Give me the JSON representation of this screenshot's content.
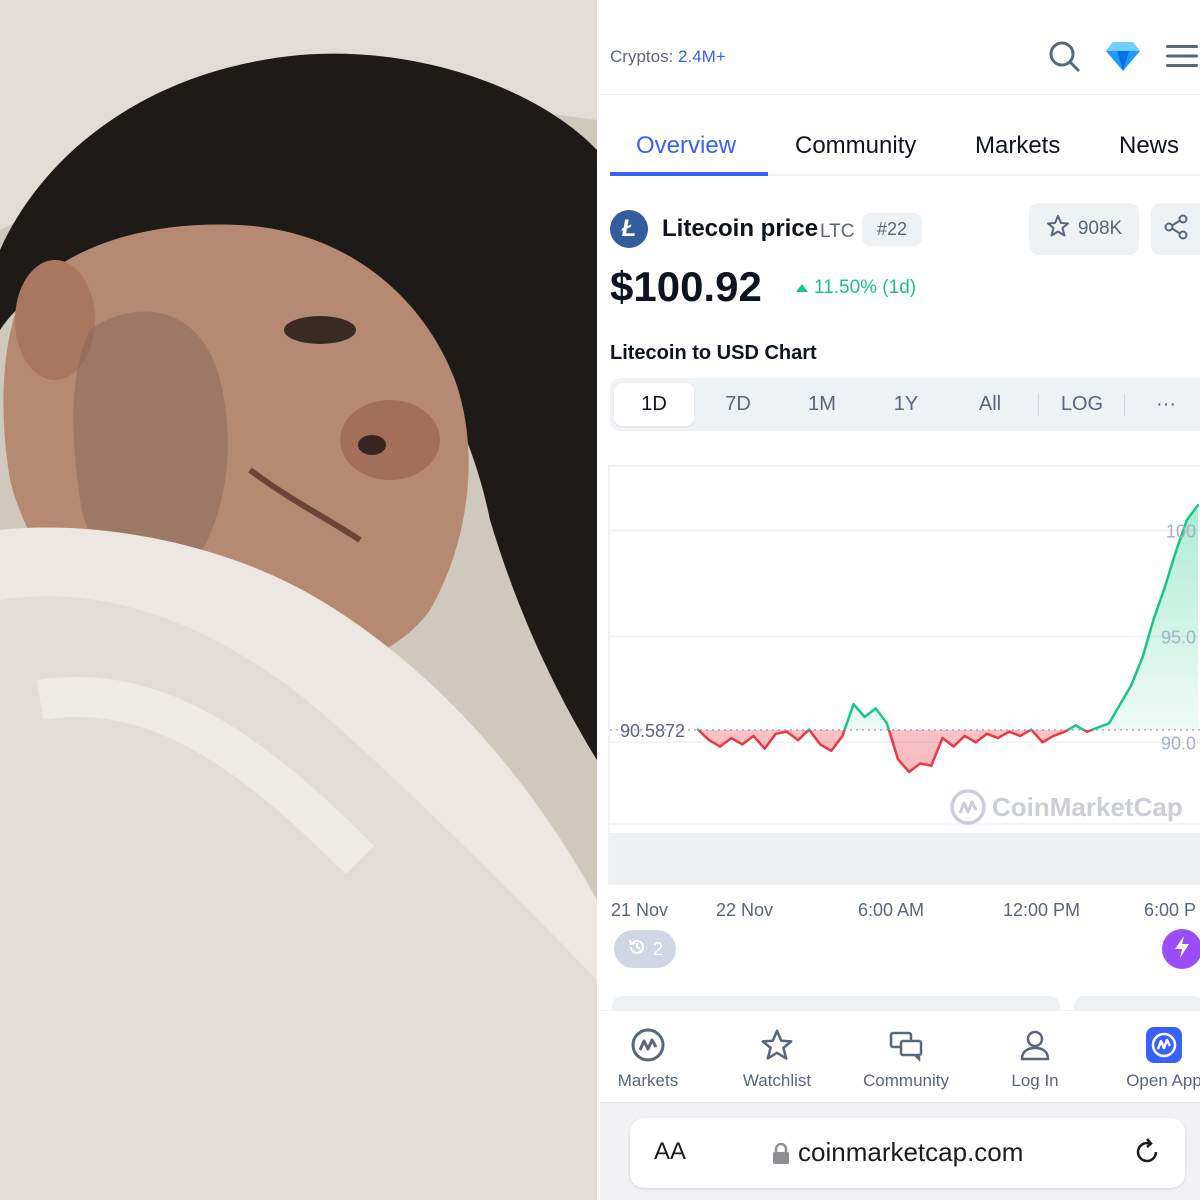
{
  "header": {
    "cryptos_label": "Cryptos:",
    "cryptos_value": "2.4M+"
  },
  "tabs": [
    {
      "label": "Overview"
    },
    {
      "label": "Community"
    },
    {
      "label": "Markets"
    },
    {
      "label": "News"
    }
  ],
  "coin": {
    "name": "Litecoin price",
    "symbol": "LTC",
    "rank": "#22",
    "watchlist_count": "908K",
    "price": "$100.92",
    "change": "11.50% (1d)"
  },
  "chart_title": "Litecoin to USD Chart",
  "ranges": [
    "1D",
    "7D",
    "1M",
    "1Y",
    "All",
    "LOG",
    "···"
  ],
  "colors": {
    "accent": "#3861fb",
    "up": "#16c784",
    "down": "#ea3943",
    "bolt": "#9b4dfb"
  },
  "chart_data": {
    "type": "line",
    "baseline": 90.5872,
    "baseline_label": "90.5872",
    "ytick_labels": [
      "100",
      "95.0",
      "90.0"
    ],
    "ylim": [
      86,
      103
    ],
    "xtick_labels": [
      "21 Nov",
      "22 Nov",
      "6:00 AM",
      "12:00 PM",
      "6:00 P"
    ],
    "watermark": "CoinMarketCap",
    "series": [
      {
        "values": [
          90.6,
          90.1,
          89.8,
          90.2,
          89.9,
          90.3,
          89.7,
          90.4,
          90.5,
          90.1,
          90.6,
          89.9,
          89.6,
          90.3,
          91.8,
          91.2,
          91.6,
          90.9,
          89.2,
          88.6,
          89.0,
          88.9,
          90.2,
          89.8,
          90.3,
          90.0,
          90.4,
          90.2,
          90.5,
          90.3,
          90.6,
          90.0,
          90.3,
          90.5,
          90.8,
          90.5,
          90.7,
          90.9,
          91.8,
          92.7,
          94.0,
          95.8,
          97.3,
          99.0,
          100.5,
          101.2
        ]
      }
    ]
  },
  "history_count": "2",
  "bottom_nav": [
    {
      "label": "Markets",
      "icon": "cmc-logo-icon"
    },
    {
      "label": "Watchlist",
      "icon": "star-icon"
    },
    {
      "label": "Community",
      "icon": "chat-bubbles-icon"
    },
    {
      "label": "Log In",
      "icon": "user-icon"
    },
    {
      "label": "Open App",
      "icon": "cmc-app-icon"
    }
  ],
  "browser": {
    "aa_label": "AA",
    "url": "coinmarketcap.com"
  }
}
